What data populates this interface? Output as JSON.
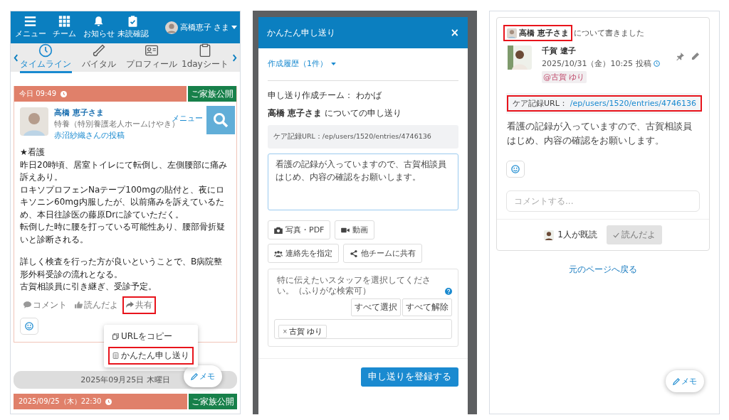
{
  "timeline_screen": {
    "nav": [
      {
        "label": "メニュー",
        "kind": "menu"
      },
      {
        "label": "チーム",
        "kind": "grid"
      },
      {
        "label": "お知らせ",
        "kind": "bell"
      },
      {
        "label": "未読確認",
        "kind": "clipboard"
      }
    ],
    "user_name": "高橋恵子 さま",
    "tabs": [
      {
        "label": "タイムライン",
        "kind": "clock",
        "selected": true
      },
      {
        "label": "バイタル",
        "kind": "thermometer",
        "selected": false
      },
      {
        "label": "プロフィール",
        "kind": "idcard",
        "selected": false
      },
      {
        "label": "1dayシート",
        "kind": "clipboard",
        "selected": false
      }
    ],
    "post": {
      "time": "今日 09:49",
      "badge": "ご家族公開",
      "resident": "高橋 恵子",
      "honorific": "さま",
      "facility": "特養（特別養護老人ホームけやき）",
      "author": "赤沼紗織さんの投稿",
      "body": [
        [
          "★看護",
          "昨日20時頃、居室トイレにて転倒し、左側腰部に痛み訴えあり。",
          "ロキソプロフェンNaテープ100mgの貼付と、夜にロキソニン60mg内服したが、以前痛みを訴えているため、本日往診医の藤原Drに診ていただく。",
          "転倒した時に腰を打っている可能性あり、腰部骨折疑いと診断される。"
        ],
        [
          "詳しく検査を行った方が良いということで、B病院整形外科受診の流れとなる。",
          "古賀相談員に引き継ぎ、受診予定。"
        ]
      ],
      "actions": [
        {
          "label": "コメント",
          "kind": "comment",
          "highlighted": false
        },
        {
          "label": "読んだよ",
          "kind": "like",
          "highlighted": false
        },
        {
          "label": "共有",
          "kind": "share",
          "highlighted": true
        }
      ]
    },
    "overlay_label": "メニュー",
    "share_menu": [
      {
        "label": "URLをコピー",
        "kind": "copy",
        "highlighted": false
      },
      {
        "label": "かんたん申し送り",
        "kind": "doc",
        "highlighted": true
      }
    ],
    "date_separator": "2025年09月25日 木曜日",
    "next_post": {
      "time": "2025/09/25（木）22:30",
      "badge": "ご家族公開"
    },
    "memo_button": "メモ"
  },
  "handover_dialog": {
    "title": "かんたん申し送り",
    "close": "×",
    "history": "作成履歴（1件）",
    "team": "申し送り作成チーム： わかば",
    "subject": "**高橋 恵子さま** についての申し送り",
    "url_line": "ケア記録URL：/ep/users/1520/entries/4746136",
    "message": "看護の記録が入っていますので、古賀相談員はじめ、内容の確認をお願いします。",
    "buttons": [
      {
        "label": "写真・PDF",
        "kind": "camera"
      },
      {
        "label": "動画",
        "kind": "video"
      },
      {
        "label": "連絡先を指定",
        "kind": "people"
      },
      {
        "label": "他チームに共有",
        "kind": "share"
      }
    ],
    "staff_hint": "特に伝えたいスタッフを選択してください。（ふりがな検索可）",
    "select_all": "すべて選択",
    "clear_all": "すべて解除",
    "selected_staff": [
      {
        "remove": "×",
        "name": "古賀 ゆり"
      }
    ],
    "submit": "申し送りを登録する"
  },
  "handover_post": {
    "subject": {
      "name": "高橋 恵子さま",
      "highlighted": true
    },
    "subject_suffix": "について書きました",
    "author": "千賀 遼子",
    "posted": "2025/10/31（金）10:25 投稿",
    "mention": "@古賀 ゆり",
    "url_label": "ケア記録URL：",
    "url": "/ep/users/1520/entries/4746136",
    "url_highlighted": true,
    "message": "看護の記録が入っていますので、古賀相談員はじめ、内容の確認をお願いします。",
    "comment_placeholder": "コメントする...",
    "read_count": "1人が既読",
    "read_button": {
      "label": "読んだよ",
      "disabled": true
    },
    "back_link": "元のページへ戻る",
    "memo_button": "メモ"
  }
}
